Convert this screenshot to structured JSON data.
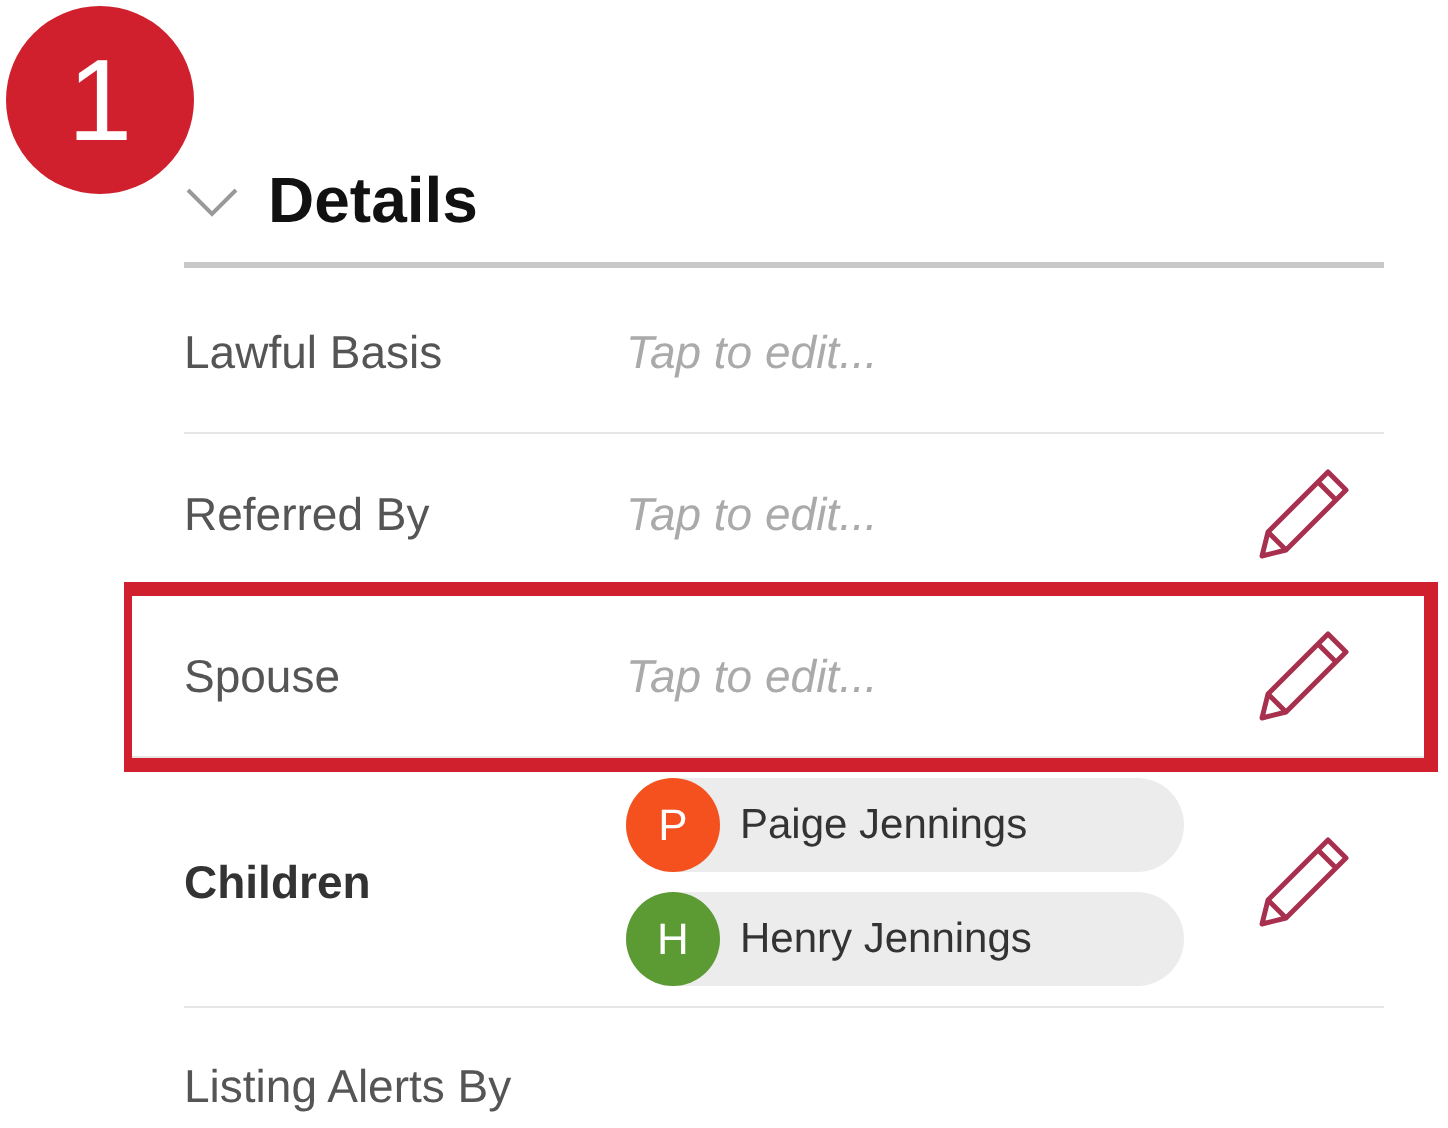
{
  "step_badge": "1",
  "section": {
    "title": "Details",
    "expanded": true
  },
  "fields": [
    {
      "label": "Lawful Basis",
      "placeholder": "Tap to edit...",
      "edit_icon": false,
      "highlighted": false,
      "bold": false
    },
    {
      "label": "Referred By",
      "placeholder": "Tap to edit...",
      "edit_icon": true,
      "highlighted": false,
      "bold": false
    },
    {
      "label": "Spouse",
      "placeholder": "Tap to edit...",
      "edit_icon": true,
      "highlighted": true,
      "bold": false
    },
    {
      "label": "Children",
      "edit_icon": true,
      "highlighted": false,
      "bold": true,
      "people": [
        {
          "initial": "P",
          "name": "Paige Jennings",
          "color": "#f4511e"
        },
        {
          "initial": "H",
          "name": "Henry Jennings",
          "color": "#5c9a34"
        }
      ]
    },
    {
      "label": "Listing Alerts By",
      "edit_icon": false,
      "highlighted": false,
      "bold": false
    }
  ]
}
